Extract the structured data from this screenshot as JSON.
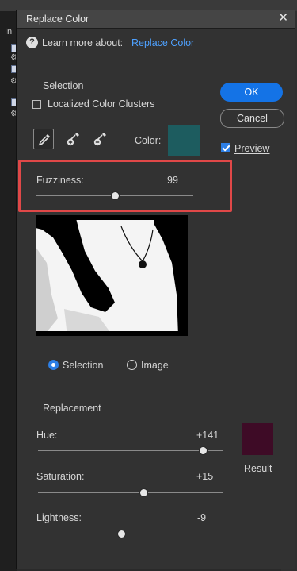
{
  "background": {
    "tab_label": "In",
    "gear_symbol": "⚙"
  },
  "dialog": {
    "title": "Replace Color",
    "close_symbol": "✕"
  },
  "help": {
    "icon_glyph": "?",
    "prefix": "Learn more about:",
    "link": "Replace Color"
  },
  "selection": {
    "heading": "Selection",
    "localized_label": "Localized Color Clusters",
    "localized_checked": false,
    "color_label": "Color:",
    "color_value": "#1d5c5f",
    "tools": [
      "eyedropper-icon",
      "eyedropper-add-icon",
      "eyedropper-subtract-icon"
    ],
    "fuzziness_label": "Fuzziness:",
    "fuzziness_value": "99",
    "fuzziness_fraction": 0.5,
    "view_selection": "Selection",
    "view_image": "Image",
    "view_active": "selection"
  },
  "buttons": {
    "ok": "OK",
    "cancel": "Cancel",
    "preview_label": "Preview",
    "preview_checked": true
  },
  "replacement": {
    "heading": "Replacement",
    "hue_label": "Hue:",
    "hue_value": "+141",
    "hue_fraction": 0.89,
    "saturation_label": "Saturation:",
    "saturation_value": "+15",
    "saturation_fraction": 0.57,
    "lightness_label": "Lightness:",
    "lightness_value": "-9",
    "lightness_fraction": 0.45,
    "result_label": "Result",
    "result_color": "#3e0b26"
  },
  "colors": {
    "accent": "#1473e6",
    "highlight": "#e04848"
  }
}
